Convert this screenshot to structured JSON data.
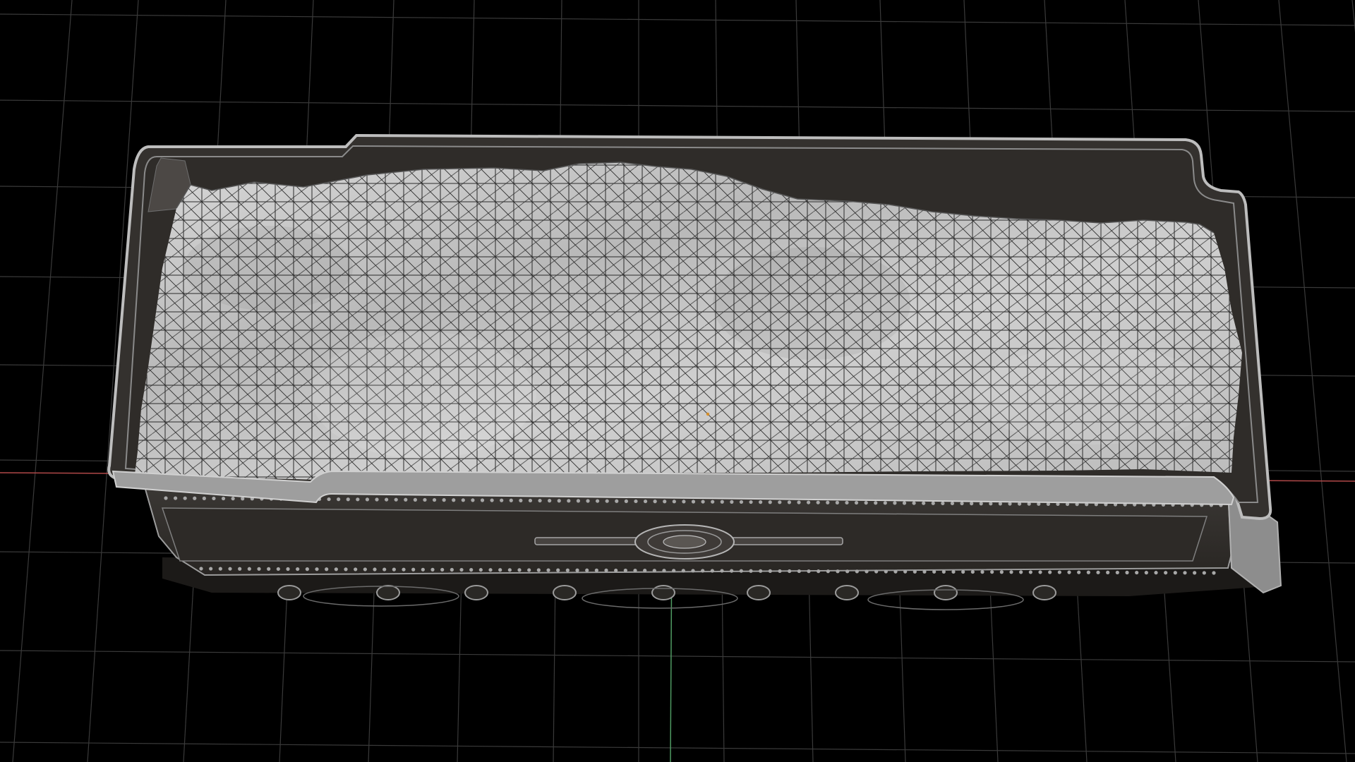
{
  "viewport": {
    "mode": "3d-viewport",
    "view": "top-perspective",
    "shading": "solid-with-wireframe-overlay",
    "show_grid": true,
    "show_axes": true
  },
  "scene_object": {
    "name_semantic": "coal-tender-model",
    "parts": [
      "tender-tank-body",
      "coal-load-mesh",
      "side-panel",
      "center-emblem",
      "rivet-rows",
      "bogie-wheels"
    ]
  },
  "colors": {
    "background": "#000000",
    "grid_line": "#3a3a3a",
    "axis_x": "#b04848",
    "axis_y": "#4f9a62",
    "tank_wall": "#34312e",
    "tank_rim": "#b4b4b4",
    "coal_surface": "#c9c9c9",
    "wire": "#2a2a2a",
    "side_panel": "#2f2c29",
    "rivet": "#a8a8a8",
    "wheel": "#9a9a9a"
  }
}
